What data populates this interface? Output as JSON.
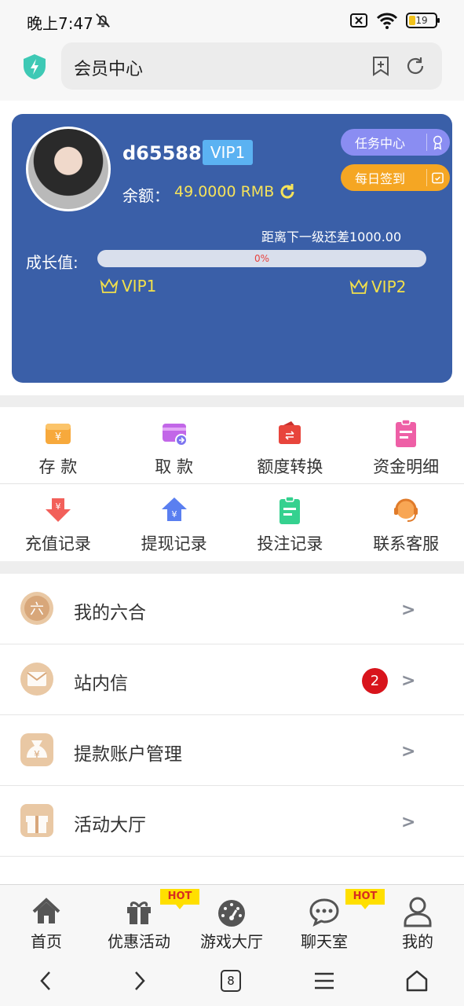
{
  "status_bar": {
    "time": "晚上7:47",
    "battery": "19"
  },
  "browser": {
    "url_title": "会员中心"
  },
  "member": {
    "username": "d65588",
    "vip_badge": "VIP1",
    "balance_label": "余额：",
    "balance_value": "49.0000 RMB",
    "task_center": "任务中心",
    "daily_signin": "每日签到",
    "next_level_text": "距离下一级还差1000.00",
    "growth_label": "成长值:",
    "progress_text": "0%",
    "progress_fraction": 0,
    "current_level": "VIP1",
    "next_level": "VIP2"
  },
  "actions": {
    "row1": [
      {
        "label": "存 款",
        "icon": "deposit-icon"
      },
      {
        "label": "取 款",
        "icon": "withdraw-icon"
      },
      {
        "label": "额度转换",
        "icon": "transfer-icon"
      },
      {
        "label": "资金明细",
        "icon": "funds-detail-icon"
      }
    ],
    "row2": [
      {
        "label": "充值记录",
        "icon": "recharge-record-icon"
      },
      {
        "label": "提现记录",
        "icon": "withdraw-record-icon"
      },
      {
        "label": "投注记录",
        "icon": "bet-record-icon"
      },
      {
        "label": "联系客服",
        "icon": "support-icon"
      }
    ]
  },
  "menu": [
    {
      "label": "我的六合",
      "arrow": ">",
      "icon_char": "六"
    },
    {
      "label": "站内信",
      "arrow": ">",
      "badge": "2"
    },
    {
      "label": "提款账户管理",
      "arrow": ">"
    },
    {
      "label": "活动大厅",
      "arrow": ">"
    }
  ],
  "tabbar": {
    "hot_tag": "HOT",
    "items": [
      {
        "label": "首页",
        "icon": "home-icon"
      },
      {
        "label": "优惠活动",
        "icon": "gift-icon"
      },
      {
        "label": "游戏大厅",
        "icon": "dashboard-icon"
      },
      {
        "label": "聊天室",
        "icon": "chat-icon"
      },
      {
        "label": "我的",
        "icon": "user-icon"
      }
    ]
  },
  "system_nav": {
    "tab_count": "8"
  },
  "colors": {
    "card_bg": "#3a5fa8",
    "accent_yellow": "#f6e35a",
    "vip_badge": "#5bb2f2",
    "task_btn": "#8a8df2",
    "daily_btn": "#f5a623",
    "badge_red": "#d8141c"
  }
}
